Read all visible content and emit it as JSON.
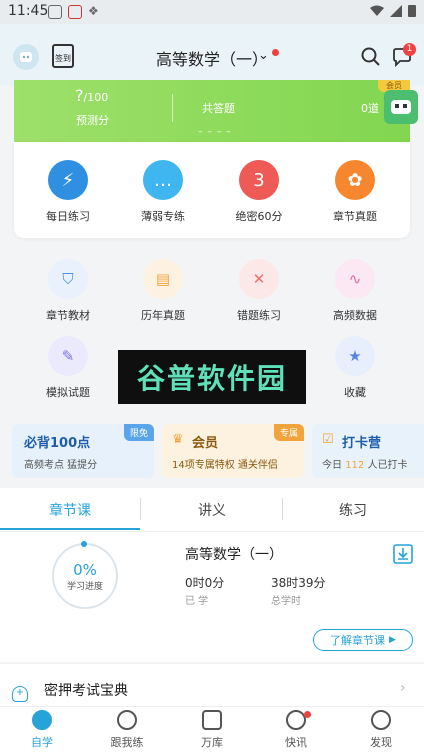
{
  "status": {
    "time": "11:45"
  },
  "header": {
    "signin_label": "签到",
    "title": "高等数学（一）",
    "caret": "⌄",
    "msg_badge": "1"
  },
  "banner": {
    "score_value": "?",
    "score_total": "/100",
    "score_label": "预测分",
    "done_label": "共答题",
    "done_dashes": "– – – –",
    "count_value": "0道",
    "vip_badge": "会员"
  },
  "quick_tiles": [
    {
      "label": "每日练习",
      "icon": "lightning-icon",
      "color": "#2f8fe0"
    },
    {
      "label": "薄弱专练",
      "icon": "chat-bubble-icon",
      "color": "#3fb6ef"
    },
    {
      "label": "绝密60分",
      "icon": "calendar-icon",
      "color": "#ee5a55"
    },
    {
      "label": "章节真题",
      "icon": "gear-icon",
      "color": "#f7872f"
    }
  ],
  "grid": [
    {
      "label": "章节教材",
      "icon": "shield-icon",
      "bg": "#e8f1fc",
      "fg": "#4d8ee8"
    },
    {
      "label": "历年真题",
      "icon": "document-icon",
      "bg": "#fdf1e2",
      "fg": "#f2a43c"
    },
    {
      "label": "错题练习",
      "icon": "error-book-icon",
      "bg": "#fde8e8",
      "fg": "#ef7070"
    },
    {
      "label": "高频数据",
      "icon": "chart-wave-icon",
      "bg": "#fbe8f2",
      "fg": "#e86aa6"
    },
    {
      "label": "模拟试题",
      "icon": "exam-paper-icon",
      "bg": "#ebeafc",
      "fg": "#7b73e8"
    },
    {
      "label": "收藏",
      "icon": "star-icon",
      "bg": "#e8effc",
      "fg": "#5a83e8"
    }
  ],
  "watermark": "谷普软件园",
  "promos": [
    {
      "title": "必背100点",
      "sub": "高频考点  猛提分",
      "tag": "限免",
      "bg": "#e6f1fb",
      "tag_bg": "#5aa5ea"
    },
    {
      "title": "会员",
      "sub": "14项专属特权  通关伴侣",
      "tag": "专属",
      "bg": "#fdf1e0",
      "tag_bg": "#f2a43c"
    },
    {
      "title": "打卡营",
      "sub_pre": "今日",
      "sub_num": "112",
      "sub_post": "人已打卡",
      "bg": "#e8f2fa"
    }
  ],
  "tabs": [
    "章节课",
    "讲义",
    "练习"
  ],
  "course": {
    "percent": "0%",
    "percent_label": "学习进度",
    "name": "高等数学（一）",
    "learned_value": "0时0分",
    "learned_label": "已 学",
    "total_value": "38时39分",
    "total_label": "总学时",
    "learn_button": "了解章节课"
  },
  "secret": {
    "label": "密押考试宝典"
  },
  "nav": [
    {
      "label": "自学",
      "active": true
    },
    {
      "label": "跟我练",
      "active": false
    },
    {
      "label": "万库",
      "active": false
    },
    {
      "label": "快讯",
      "active": false
    },
    {
      "label": "发现",
      "active": false
    }
  ]
}
